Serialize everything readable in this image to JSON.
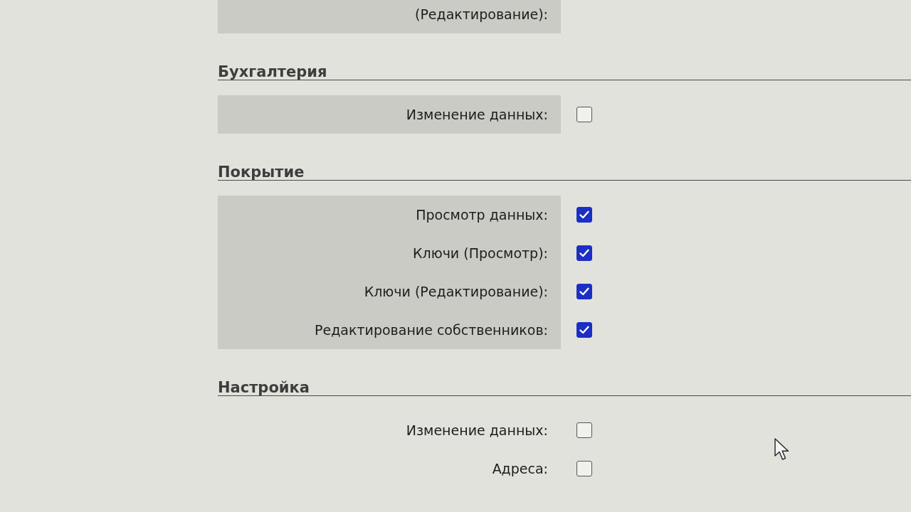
{
  "partial_row": {
    "label": "(Редактирование):"
  },
  "sections": [
    {
      "title": "Бухгалтерия",
      "shaded": true,
      "rows": [
        {
          "label": "Изменение данных:",
          "checked": false
        }
      ]
    },
    {
      "title": "Покрытие",
      "shaded": true,
      "rows": [
        {
          "label": "Просмотр данных:",
          "checked": true
        },
        {
          "label": "Ключи (Просмотр):",
          "checked": true
        },
        {
          "label": "Ключи (Редактирование):",
          "checked": true
        },
        {
          "label": "Редактирование собственников:",
          "checked": true
        }
      ]
    },
    {
      "title": "Настройка",
      "shaded": false,
      "rows": [
        {
          "label": "Изменение данных:",
          "checked": false
        },
        {
          "label": "Адреса:",
          "checked": false
        }
      ]
    }
  ]
}
